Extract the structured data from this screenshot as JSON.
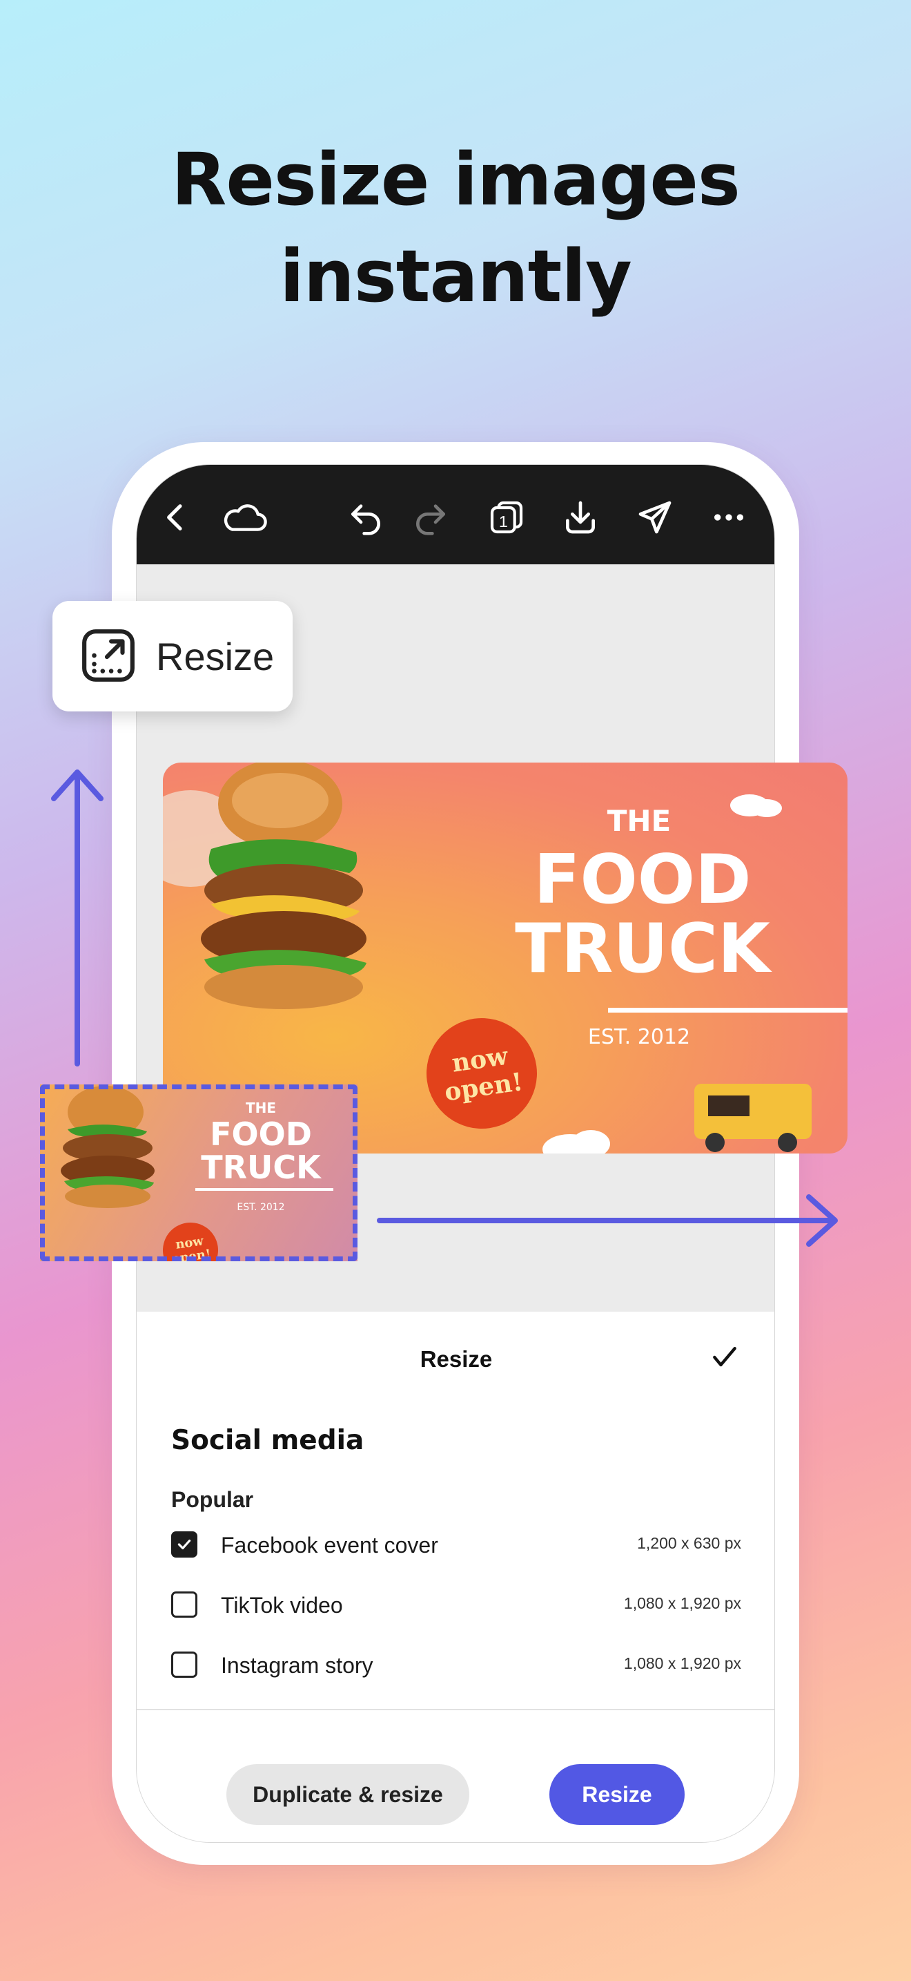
{
  "headline": {
    "line1": "Resize images",
    "line2": "instantly"
  },
  "chip": {
    "label": "Resize",
    "icon": "resize-icon"
  },
  "toolbar": {
    "icons": [
      "back-icon",
      "cloud-icon",
      "undo-icon",
      "redo-icon",
      "pages-icon",
      "download-icon",
      "share-icon",
      "more-icon"
    ],
    "pages_count": "1"
  },
  "banner": {
    "the": "THE",
    "food": "FOOD",
    "truck": "TRUCK",
    "est": "EST. 2012",
    "now": "now",
    "open": "open!"
  },
  "sheet": {
    "title": "Resize",
    "section": "Social media",
    "subsection": "Popular",
    "options": [
      {
        "label": "Facebook event cover",
        "size": "1,200 x 630 px",
        "checked": true
      },
      {
        "label": "TikTok video",
        "size": "1,080 x 1,920 px",
        "checked": false
      },
      {
        "label": "Instagram story",
        "size": "1,080 x 1,920 px",
        "checked": false
      }
    ],
    "duplicate_label": "Duplicate & resize",
    "resize_label": "Resize"
  },
  "colors": {
    "accent": "#5258e4",
    "arrow": "#5a5ae0",
    "toolbar": "#1b1b1b"
  }
}
